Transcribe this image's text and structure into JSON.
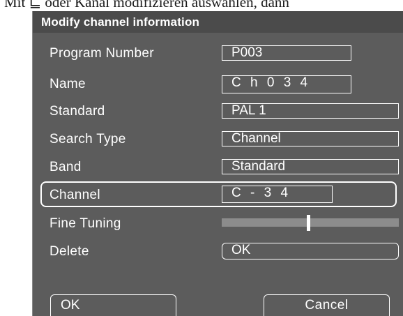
{
  "page_header_text": "Mit  ⊑ oder   Kanal modifizieren auswählen, dann",
  "dialog": {
    "title": "Modify channel information",
    "rows": [
      {
        "label": "Program Number",
        "value": "P003"
      },
      {
        "label": "Name",
        "value": "C h 0 3 4"
      },
      {
        "label": "Standard",
        "value": "PAL 1"
      },
      {
        "label": "Search Type",
        "value": "Channel"
      },
      {
        "label": "Band",
        "value": "Standard"
      },
      {
        "label": "Channel",
        "value": "C - 3 4"
      },
      {
        "label": "Fine Tuning",
        "value_fraction": 0.49
      },
      {
        "label": "Delete",
        "value": "OK"
      }
    ],
    "selected_row": "Channel",
    "buttons": {
      "ok": "OK",
      "cancel": "Cancel"
    }
  },
  "colors": {
    "dialog_background": "#5c5c5c",
    "title_background": "#4b4b4b",
    "text": "#ffffff",
    "slider_track": "#8c8c8c"
  }
}
